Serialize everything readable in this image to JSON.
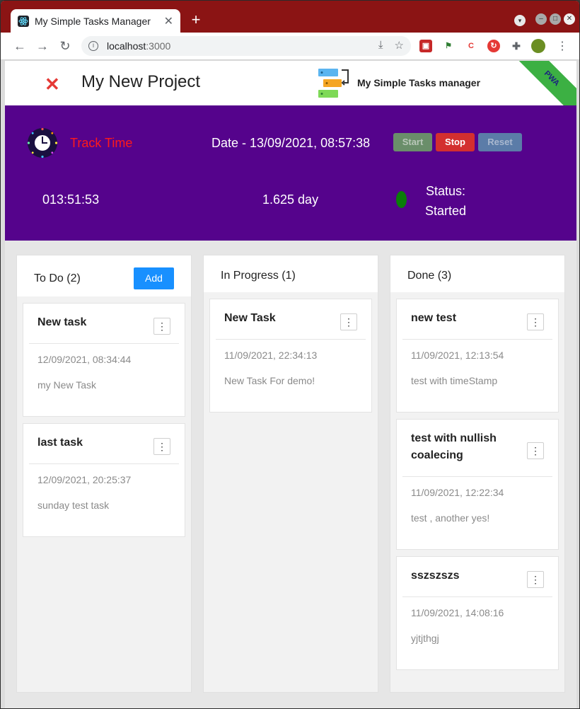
{
  "browser": {
    "tab_title": "My Simple Tasks Manager",
    "new_tab_label": "+",
    "url_host": "localhost",
    "url_port": ":3000"
  },
  "header": {
    "project_name": "My New Project",
    "app_name": "My Simple Tasks manager",
    "ribbon": "PWA"
  },
  "timer": {
    "label": "Track Time",
    "date_text": "Date - 13/09/2021, 08:57:38",
    "start_label": "Start",
    "stop_label": "Stop",
    "reset_label": "Reset",
    "elapsed": "013:51:53",
    "days": "1.625 day",
    "status_line1": "Status:",
    "status_line2": "Started",
    "status_color": "#0a7d0a"
  },
  "columns": [
    {
      "title": "To Do (2)",
      "add_label": "Add",
      "cards": [
        {
          "title": "New task",
          "date": "12/09/2021, 08:34:44",
          "desc": "my New Task"
        },
        {
          "title": "last task",
          "date": "12/09/2021, 20:25:37",
          "desc": "sunday test task"
        }
      ]
    },
    {
      "title": "In Progress (1)",
      "cards": [
        {
          "title": "New Task",
          "date": "11/09/2021, 22:34:13",
          "desc": "New Task For demo!"
        }
      ]
    },
    {
      "title": "Done (3)",
      "cards": [
        {
          "title": "new test",
          "date": "11/09/2021, 12:13:54",
          "desc": "test with timeStamp"
        },
        {
          "title": "test with nullish coalecing",
          "date": "11/09/2021, 12:22:34",
          "desc": "test , another yes!"
        },
        {
          "title": "sszszszs",
          "date": "11/09/2021, 14:08:16",
          "desc": "yjtjthgj"
        }
      ]
    }
  ],
  "colors": {
    "purple_bar": "#55038c",
    "accent_blue": "#1890ff",
    "stop_red": "#d32f2f",
    "track_red": "#ff1a1a"
  }
}
